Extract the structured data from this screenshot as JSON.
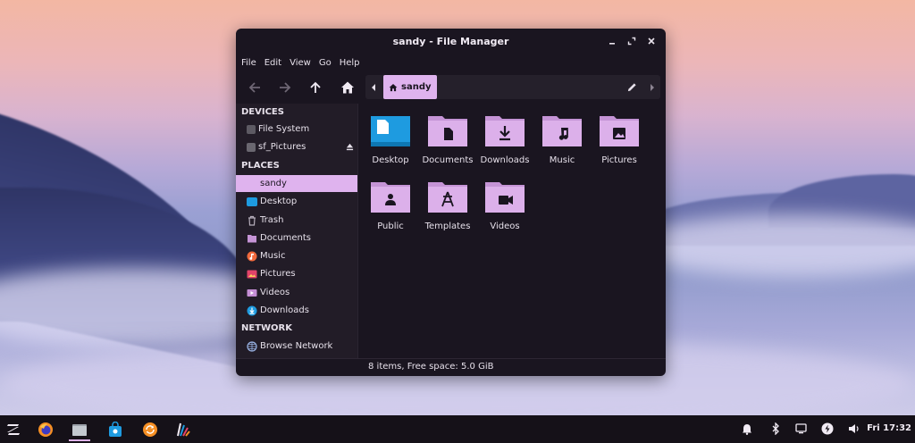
{
  "window": {
    "title": "sandy - File Manager"
  },
  "menubar": {
    "items": [
      "File",
      "Edit",
      "View",
      "Go",
      "Help"
    ]
  },
  "toolbar": {
    "path_current": "sandy"
  },
  "sidebar": {
    "headers": {
      "devices": "DEVICES",
      "places": "PLACES",
      "network": "NETWORK"
    },
    "devices": [
      {
        "label": "File System",
        "icon": "drive-icon"
      },
      {
        "label": "sf_Pictures",
        "icon": "drive-removable-icon"
      }
    ],
    "places": [
      {
        "label": "sandy",
        "icon": "home-icon",
        "selected": true
      },
      {
        "label": "Desktop",
        "icon": "desktop-icon"
      },
      {
        "label": "Trash",
        "icon": "trash-icon"
      },
      {
        "label": "Documents",
        "icon": "documents-icon"
      },
      {
        "label": "Music",
        "icon": "music-icon"
      },
      {
        "label": "Pictures",
        "icon": "pictures-icon"
      },
      {
        "label": "Videos",
        "icon": "videos-icon"
      },
      {
        "label": "Downloads",
        "icon": "downloads-icon"
      }
    ],
    "network": [
      {
        "label": "Browse Network",
        "icon": "network-icon"
      }
    ]
  },
  "content": {
    "items": [
      {
        "label": "Desktop",
        "icon": "desktop-folder-icon"
      },
      {
        "label": "Documents",
        "icon": "documents-folder-icon"
      },
      {
        "label": "Downloads",
        "icon": "downloads-folder-icon"
      },
      {
        "label": "Music",
        "icon": "music-folder-icon"
      },
      {
        "label": "Pictures",
        "icon": "pictures-folder-icon"
      },
      {
        "label": "Public",
        "icon": "public-folder-icon"
      },
      {
        "label": "Templates",
        "icon": "templates-folder-icon"
      },
      {
        "label": "Videos",
        "icon": "videos-folder-icon"
      }
    ]
  },
  "statusbar": {
    "text": "8 items, Free space: 5.0 GiB"
  },
  "taskbar": {
    "clock": "Fri 17:32"
  },
  "colors": {
    "accent": "#dfb3ee",
    "window_bg": "#1a1520",
    "sidebar_bg": "#221c27",
    "taskbar_bg": "#151118",
    "folder": "#dcb0ea",
    "folder_tab": "#c594d6",
    "desktop_blue": "#1e9be0"
  }
}
